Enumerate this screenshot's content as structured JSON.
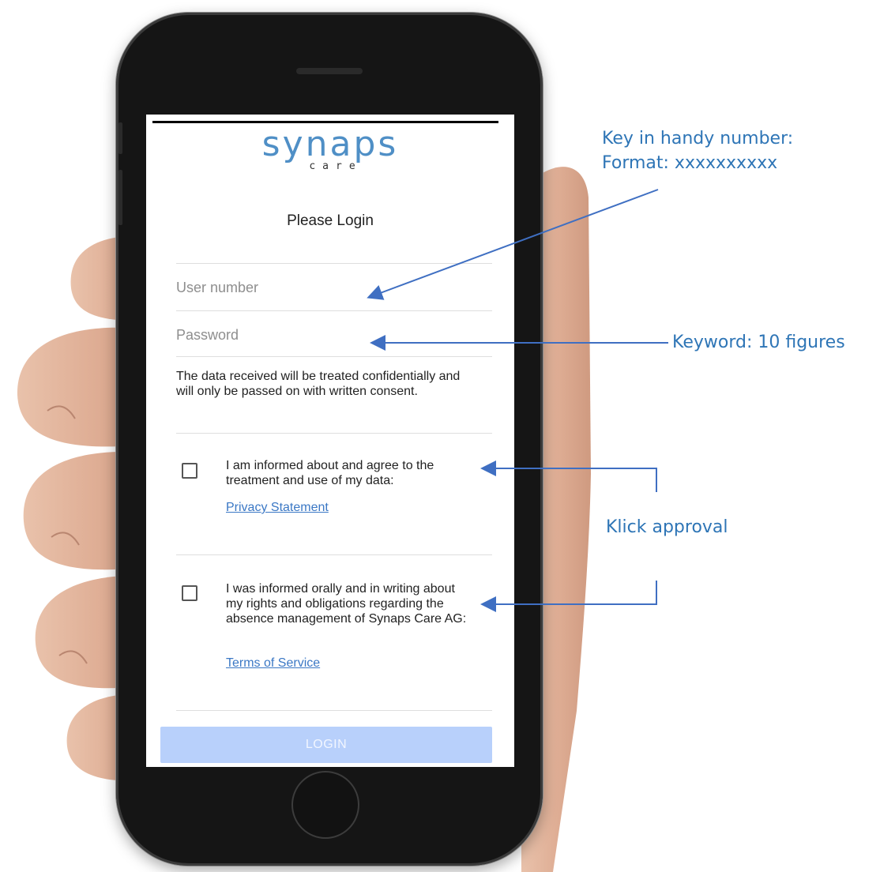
{
  "app": {
    "logo_text": "synaps",
    "logo_subtext": "care",
    "title": "Please Login"
  },
  "form": {
    "user_placeholder": "User number",
    "password_placeholder": "Password",
    "notice": "The data received will be treated confidentially and will only be passed on with written consent.",
    "consent_1_text": "I am informed about and agree to the treatment and use of my data:",
    "consent_1_link": "Privacy Statement",
    "consent_2_text": "I was informed orally and in writing about my rights and obligations regarding the absence management of Synaps Care AG:",
    "consent_2_link": "Terms of Service",
    "login_label": "LOGIN"
  },
  "annotations": {
    "handy_line1": "Key in handy number:",
    "handy_line2": "Format: xxxxxxxxxx",
    "keyword": "Keyword: 10 figures",
    "approval": "Klick approval"
  },
  "colors": {
    "annotation": "#2e75b6",
    "logo": "#4f8fc6",
    "link": "#3b78c5",
    "login_button": "#b8d0fb"
  }
}
